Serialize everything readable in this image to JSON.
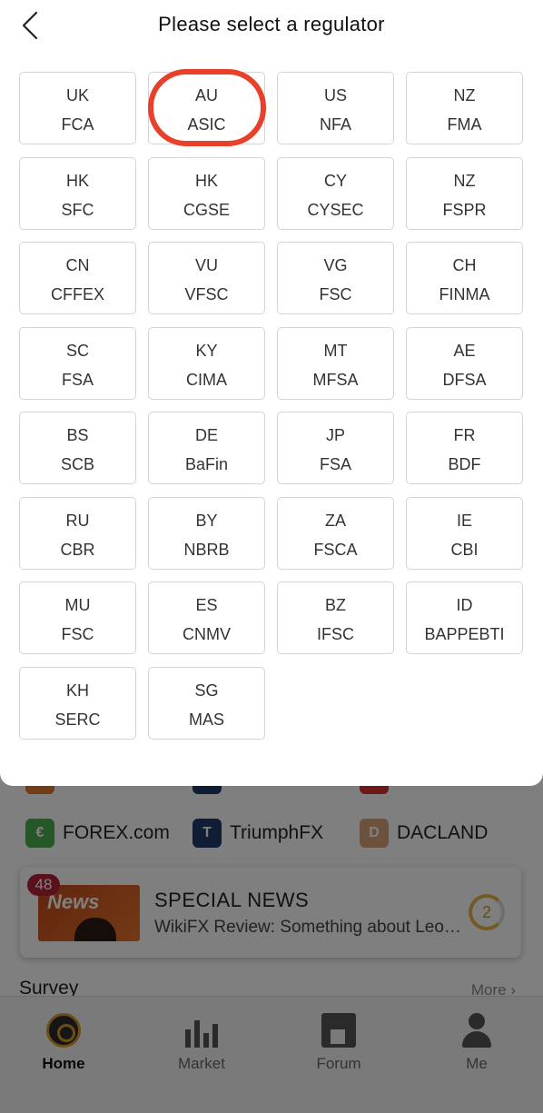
{
  "modal": {
    "title": "Please select a regulator",
    "regulators": [
      {
        "country": "UK",
        "regulator": "FCA"
      },
      {
        "country": "AU",
        "regulator": "ASIC"
      },
      {
        "country": "US",
        "regulator": "NFA"
      },
      {
        "country": "NZ",
        "regulator": "FMA"
      },
      {
        "country": "HK",
        "regulator": "SFC"
      },
      {
        "country": "HK",
        "regulator": "CGSE"
      },
      {
        "country": "CY",
        "regulator": "CYSEC"
      },
      {
        "country": "NZ",
        "regulator": "FSPR"
      },
      {
        "country": "CN",
        "regulator": "CFFEX"
      },
      {
        "country": "VU",
        "regulator": "VFSC"
      },
      {
        "country": "VG",
        "regulator": "FSC"
      },
      {
        "country": "CH",
        "regulator": "FINMA"
      },
      {
        "country": "SC",
        "regulator": "FSA"
      },
      {
        "country": "KY",
        "regulator": "CIMA"
      },
      {
        "country": "MT",
        "regulator": "MFSA"
      },
      {
        "country": "AE",
        "regulator": "DFSA"
      },
      {
        "country": "BS",
        "regulator": "SCB"
      },
      {
        "country": "DE",
        "regulator": "BaFin"
      },
      {
        "country": "JP",
        "regulator": "FSA"
      },
      {
        "country": "FR",
        "regulator": "BDF"
      },
      {
        "country": "RU",
        "regulator": "CBR"
      },
      {
        "country": "BY",
        "regulator": "NBRB"
      },
      {
        "country": "ZA",
        "regulator": "FSCA"
      },
      {
        "country": "IE",
        "regulator": "CBI"
      },
      {
        "country": "MU",
        "regulator": "FSC"
      },
      {
        "country": "ES",
        "regulator": "CNMV"
      },
      {
        "country": "BZ",
        "regulator": "IFSC"
      },
      {
        "country": "ID",
        "regulator": "BAPPEBTI"
      },
      {
        "country": "KH",
        "regulator": "SERC"
      },
      {
        "country": "SG",
        "regulator": "MAS"
      }
    ],
    "highlighted_index": 1,
    "highlight_color": "#e8402a"
  },
  "background": {
    "brokers": [
      {
        "name": "FOREX.com",
        "color": "#4caf50",
        "icon": "forex-logo"
      },
      {
        "name": "TriumphFX",
        "color": "#1f3a6b",
        "icon": "triumphfx-logo"
      },
      {
        "name": "DACLAND",
        "color": "#d9a27a",
        "icon": "dacland-logo"
      }
    ],
    "news": {
      "badge": "48",
      "thumb_word": "News",
      "title": "SPECIAL NEWS",
      "subtitle": "WikiFX Review: Something about Leo…",
      "count": "2"
    },
    "section_title": "Survey",
    "more_label": "More"
  },
  "tabbar": {
    "tabs": [
      {
        "label": "Home",
        "icon": "home-icon",
        "active": true
      },
      {
        "label": "Market",
        "icon": "market-icon",
        "active": false
      },
      {
        "label": "Forum",
        "icon": "forum-icon",
        "active": false
      },
      {
        "label": "Me",
        "icon": "me-icon",
        "active": false
      }
    ]
  },
  "colors": {
    "accent_gold": "#d69a2c",
    "overlay": "rgba(0,0,0,0.5)"
  }
}
